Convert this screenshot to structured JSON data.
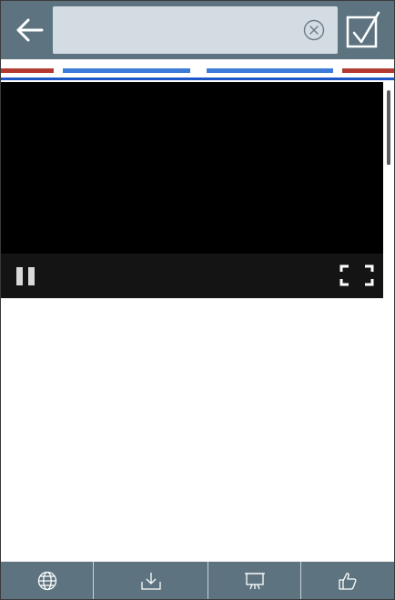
{
  "colors": {
    "toolbar": "#5d7480",
    "search_bg": "#d3dce3",
    "stripe_red": "#b33a30",
    "stripe_blue": "#3d7bdb",
    "stripe_base": "#1c56c7",
    "video_bg": "#000000",
    "video_controls_bg": "#141414"
  },
  "header": {
    "back_icon": "arrow-left-icon",
    "search": {
      "value": "",
      "placeholder": ""
    },
    "clear_icon": "circle-x-icon",
    "confirm_icon": "checkbox-check-icon"
  },
  "video_player": {
    "state": "playing",
    "pause_icon": "pause-icon",
    "fullscreen_icon": "fullscreen-icon"
  },
  "bottom_toolbar": {
    "items": [
      {
        "icon": "globe-icon"
      },
      {
        "icon": "download-icon"
      },
      {
        "icon": "presentation-icon"
      },
      {
        "icon": "thumbs-up-icon"
      }
    ]
  }
}
